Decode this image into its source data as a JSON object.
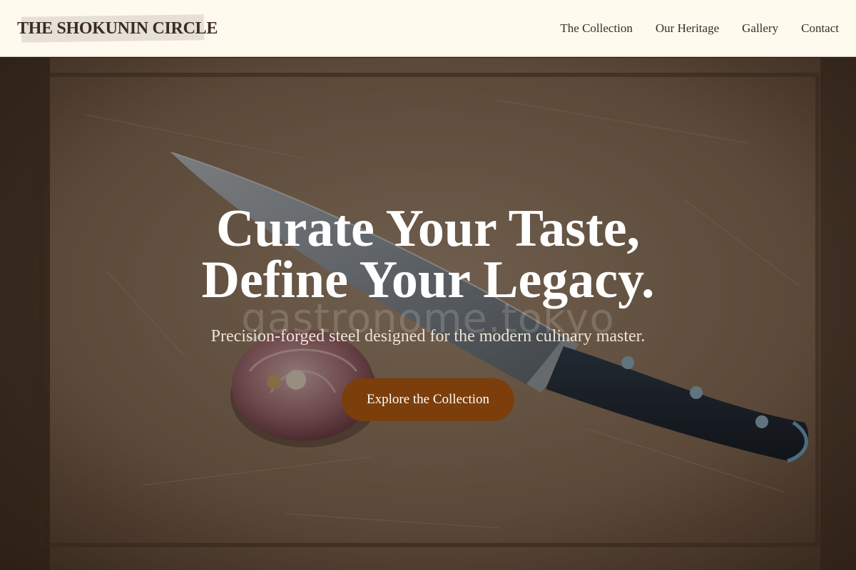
{
  "header": {
    "brand": "THE SHOKUNIN CIRCLE",
    "nav": [
      {
        "label": "The Collection"
      },
      {
        "label": "Our Heritage"
      },
      {
        "label": "Gallery"
      },
      {
        "label": "Contact"
      }
    ]
  },
  "hero": {
    "title_line1": "Curate Your Taste,",
    "title_line2": "Define Your Legacy.",
    "watermark": "gastronome.tokyo",
    "subtitle": "Precision-forged steel designed for the modern culinary master.",
    "cta_label": "Explore the Collection"
  },
  "colors": {
    "header_bg": "#fffaee",
    "brand_text": "#3a2c25",
    "cta_bg": "#7c3e0a",
    "title_text": "#ffffff"
  },
  "icons": [
    "chef-knife-image",
    "garlic-bulb-image",
    "cutting-board-image"
  ]
}
